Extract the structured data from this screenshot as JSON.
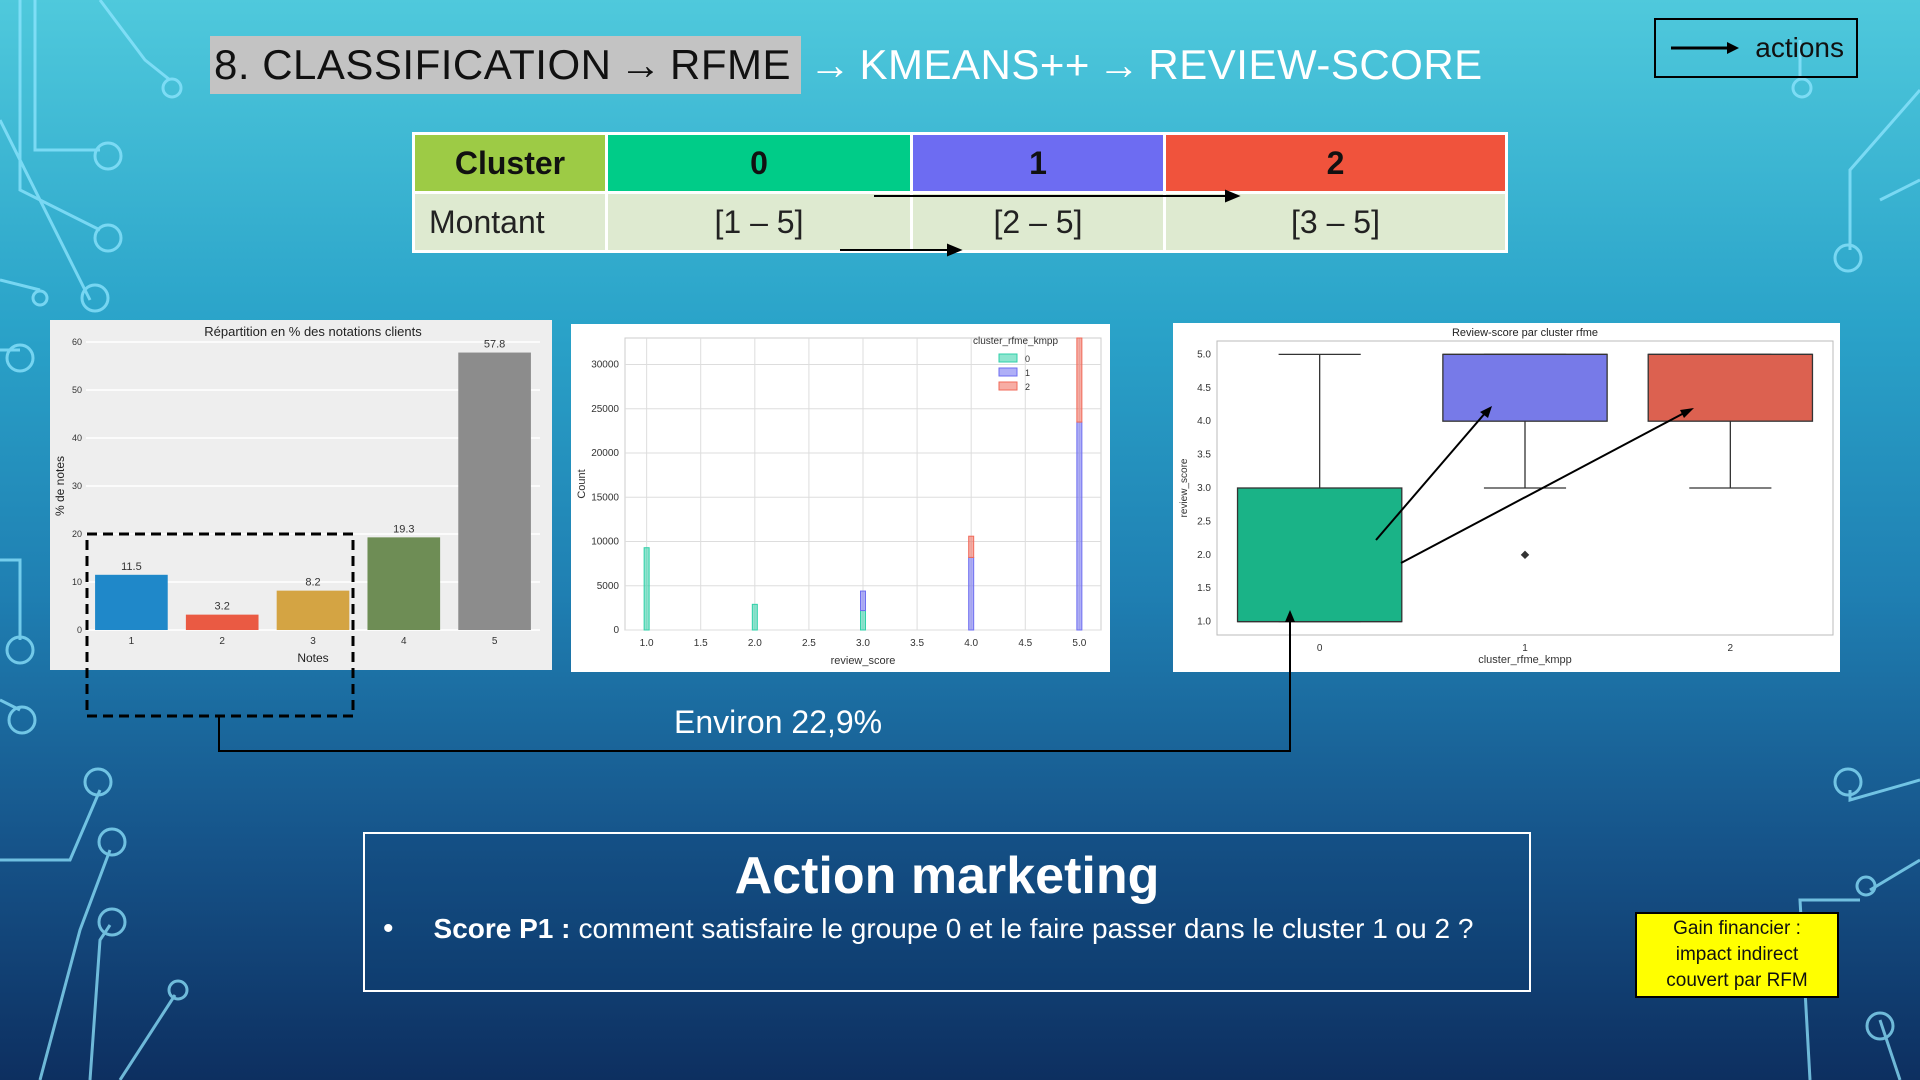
{
  "title": {
    "highlight": "8. CLASSIFICATION",
    "part_rfme": "RFME",
    "part_kmeans": "KMEANS++",
    "part_review": "REVIEW-SCORE",
    "arrow": "→"
  },
  "legend": {
    "label": "actions"
  },
  "cluster_table": {
    "header": [
      {
        "label": "Cluster",
        "color": "#9dcb45"
      },
      {
        "label": "0",
        "color": "#00cc88"
      },
      {
        "label": "1",
        "color": "#6d6cf2"
      },
      {
        "label": "2",
        "color": "#f0533c"
      }
    ],
    "row_label": "Montant",
    "row_values": [
      "[1 – 5]",
      "[2 – 5]",
      "[3 – 5]"
    ]
  },
  "chart_data": [
    {
      "type": "bar",
      "title": "Répartition en % des notations clients",
      "xlabel": "Notes",
      "ylabel": "% de notes",
      "categories": [
        "1",
        "2",
        "3",
        "4",
        "5"
      ],
      "values": [
        11.5,
        3.2,
        8.2,
        19.3,
        57.8
      ],
      "data_labels": [
        "11.5",
        "3.2",
        "8.2",
        "19.3",
        "57.8"
      ],
      "colors": [
        "#1f88c9",
        "#ea5a43",
        "#d4a443",
        "#6e8d55",
        "#8c8c8c"
      ],
      "ylim": [
        0,
        60
      ],
      "yticks": [
        "0",
        "10",
        "20",
        "30",
        "40",
        "50",
        "60"
      ],
      "grid": true
    },
    {
      "type": "bar",
      "title": "",
      "xlabel": "review_score",
      "ylabel": "Count",
      "legend_title": "cluster_rfme_kmpp",
      "legend_position": "top-right",
      "x": [
        1.0,
        2.0,
        3.0,
        4.0,
        5.0
      ],
      "xticks": [
        "1.0",
        "1.5",
        "2.0",
        "2.5",
        "3.0",
        "3.5",
        "4.0",
        "4.5",
        "5.0"
      ],
      "yticks": [
        "0",
        "5000",
        "10000",
        "15000",
        "20000",
        "25000",
        "30000"
      ],
      "ylim": [
        0,
        33000
      ],
      "grid": true,
      "series": [
        {
          "name": "0",
          "values": [
            9300,
            2900,
            2200,
            0,
            0
          ],
          "color": "#2fd0a8"
        },
        {
          "name": "1",
          "values": [
            0,
            0,
            2200,
            8200,
            23500
          ],
          "color": "#6e6ef0"
        },
        {
          "name": "2",
          "values": [
            0,
            0,
            0,
            2400,
            9500
          ],
          "color": "#f06a5a"
        }
      ]
    },
    {
      "type": "box",
      "title": "Review-score par cluster rfme",
      "xlabel": "cluster_rfme_kmpp",
      "ylabel": "review_score",
      "categories": [
        "0",
        "1",
        "2"
      ],
      "yticks": [
        "1.0",
        "1.5",
        "2.0",
        "2.5",
        "3.0",
        "3.5",
        "4.0",
        "4.5",
        "5.0"
      ],
      "ylim": [
        0.8,
        5.2
      ],
      "boxes": [
        {
          "min": 1.0,
          "q1": 1.0,
          "median": 1.0,
          "q3": 3.0,
          "max": 5.0,
          "outliers": [],
          "color": "#1ab387"
        },
        {
          "min": 3.0,
          "q1": 4.0,
          "median": 5.0,
          "q3": 5.0,
          "max": 5.0,
          "outliers": [
            2.0
          ],
          "color": "#777ae8"
        },
        {
          "min": 3.0,
          "q1": 4.0,
          "median": 5.0,
          "q3": 5.0,
          "max": 5.0,
          "outliers": [],
          "color": "#dc6150"
        }
      ]
    }
  ],
  "environ_label": "Environ 22,9%",
  "action": {
    "title": "Action marketing",
    "bullet": "•",
    "strong": "Score P1 :",
    "text": "comment satisfaire le groupe 0 et le faire passer dans le cluster 1 ou 2 ?"
  },
  "gain_box": {
    "line1": "Gain financier :",
    "line2": "impact indirect",
    "line3": "couvert par RFM"
  }
}
